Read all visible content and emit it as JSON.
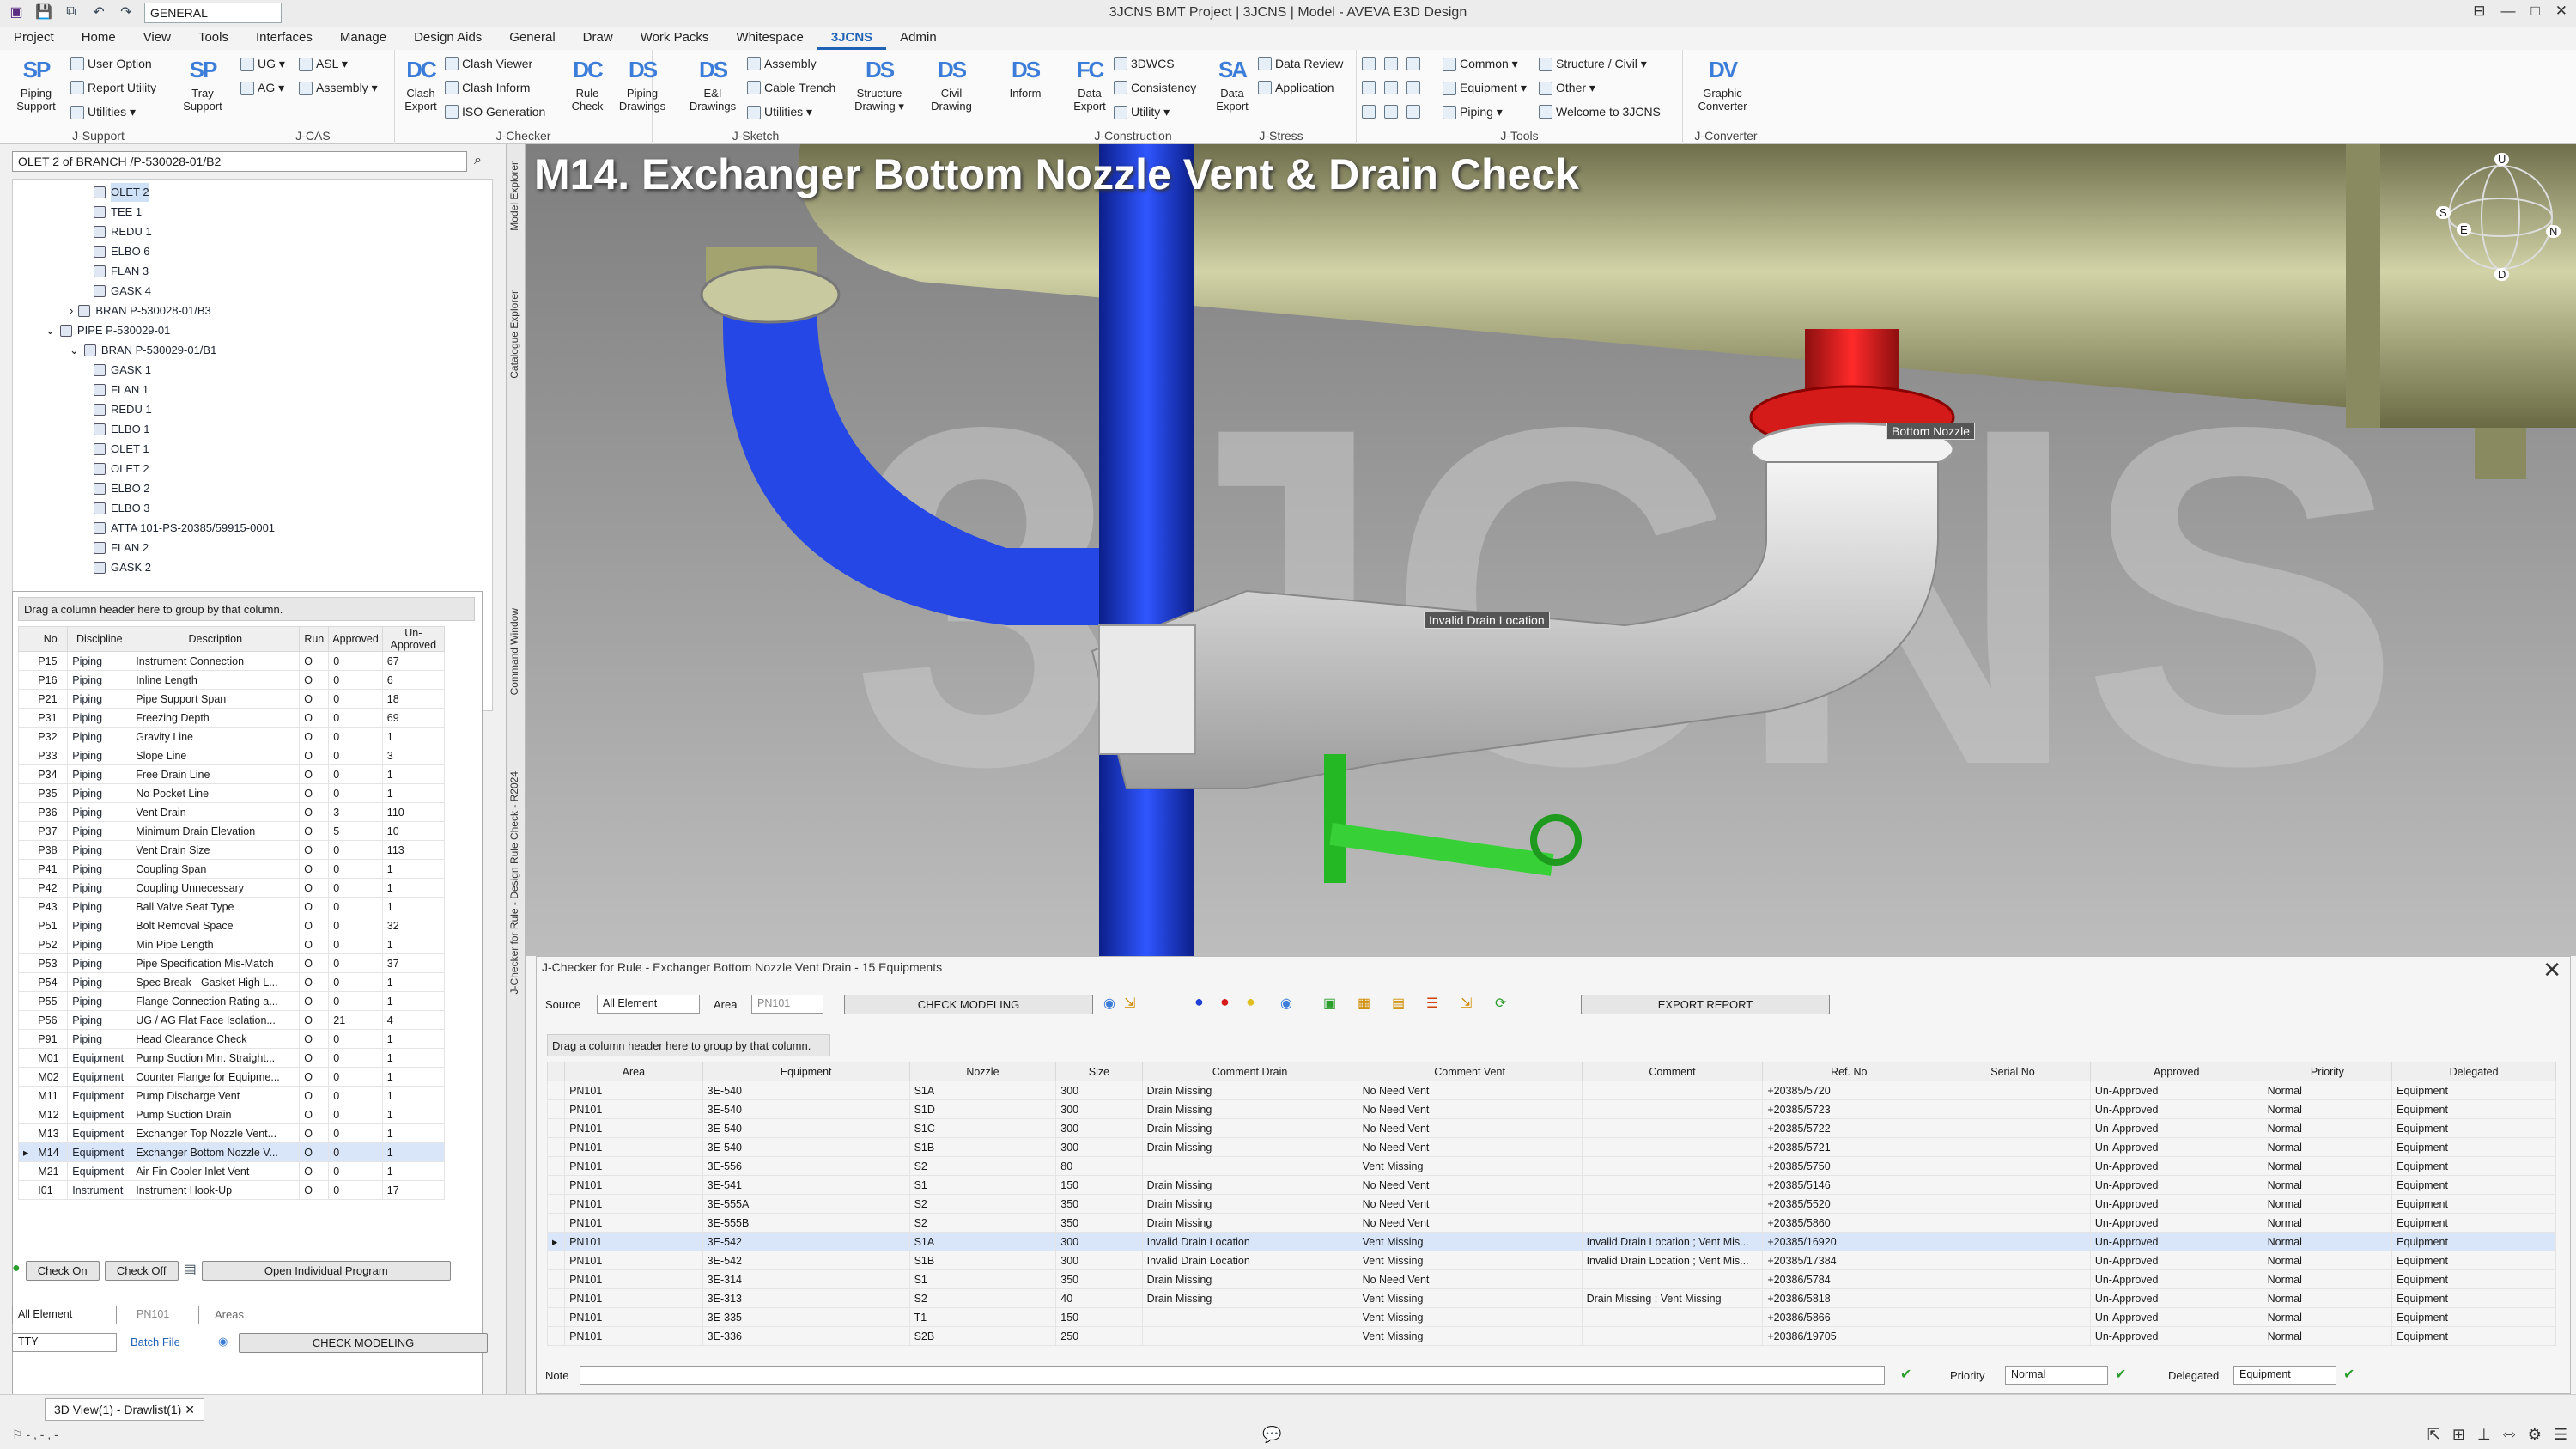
{
  "window": {
    "title": "3JCNS BMT Project | 3JCNS | Model - AVEVA E3D Design",
    "workspace": "GENERAL"
  },
  "menu": [
    "Project",
    "Home",
    "View",
    "Tools",
    "Interfaces",
    "Manage",
    "Design Aids",
    "General",
    "Draw",
    "Work Packs",
    "Whitespace",
    "3JCNS",
    "Admin"
  ],
  "ribbon": {
    "groups": [
      {
        "label": "J-Support",
        "big": [
          {
            "icon": "SP",
            "label": "Piping Support"
          }
        ],
        "small": [
          "User Option",
          "Report Utility",
          "Utilities ▾"
        ],
        "big2": [
          {
            "icon": "SP",
            "label": "Tray Support"
          }
        ]
      },
      {
        "label": "J-CAS",
        "small": [
          "UG ▾",
          "AG ▾",
          "ASL ▾",
          "Assembly ▾"
        ]
      },
      {
        "label": "J-Checker",
        "big": [
          {
            "icon": "DC",
            "label": "Clash Export"
          },
          {
            "icon": "DC",
            "label": "Rule Check"
          }
        ],
        "small": [
          "Clash Viewer",
          "Clash Inform",
          "ISO Generation"
        ]
      },
      {
        "label": "J-Sketch",
        "big": [
          {
            "icon": "DS",
            "label": "Piping Drawings"
          },
          {
            "icon": "DS",
            "label": "E&I Drawings"
          },
          {
            "icon": "DS",
            "label": "Structure Drawing ▾"
          },
          {
            "icon": "DS",
            "label": "Civil Drawing"
          },
          {
            "icon": "DS",
            "label": "Inform"
          }
        ],
        "small": [
          "Assembly",
          "Cable Trench",
          "Utilities ▾"
        ]
      },
      {
        "label": "J-Construction",
        "big": [
          {
            "icon": "FC",
            "label": "Data Export"
          }
        ],
        "small": [
          "3DWCS",
          "Consistency",
          "Utility ▾"
        ]
      },
      {
        "label": "J-Stress",
        "big": [
          {
            "icon": "SA",
            "label": "Data Export"
          }
        ],
        "small": [
          "Data Review",
          "Application"
        ]
      },
      {
        "label": "J-Tools",
        "small": [
          "Common ▾",
          "Equipment ▾",
          "Piping ▾",
          "Structure / Civil ▾",
          "Other ▾",
          "Welcome to 3JCNS"
        ]
      },
      {
        "label": "J-Converter",
        "big": [
          {
            "icon": "DV",
            "label": "Graphic Converter"
          }
        ]
      }
    ]
  },
  "explorer": {
    "address": "OLET 2 of BRANCH /P-530028-01/B2",
    "tabs": [
      "Model Explorer",
      "Catalogue Explorer",
      "Command Window",
      "J-Checker for Rule - Design Rule Check - R2024"
    ],
    "nodes": [
      {
        "label": "OLET 2",
        "indent": 3,
        "selected": true
      },
      {
        "label": "TEE 1",
        "indent": 3
      },
      {
        "label": "REDU 1",
        "indent": 3
      },
      {
        "label": "ELBO 6",
        "indent": 3
      },
      {
        "label": "FLAN 3",
        "indent": 3
      },
      {
        "label": "GASK 4",
        "indent": 3
      },
      {
        "label": "BRAN P-530028-01/B3",
        "indent": 2,
        "expander": "›"
      },
      {
        "label": "PIPE P-530029-01",
        "indent": 1,
        "expander": "⌄"
      },
      {
        "label": "BRAN P-530029-01/B1",
        "indent": 2,
        "expander": "⌄"
      },
      {
        "label": "GASK 1",
        "indent": 3
      },
      {
        "label": "FLAN 1",
        "indent": 3
      },
      {
        "label": "REDU 1",
        "indent": 3
      },
      {
        "label": "ELBO 1",
        "indent": 3
      },
      {
        "label": "OLET 1",
        "indent": 3
      },
      {
        "label": "OLET 2",
        "indent": 3
      },
      {
        "label": "ELBO 2",
        "indent": 3
      },
      {
        "label": "ELBO 3",
        "indent": 3
      },
      {
        "label": "ATTA 101-PS-20385/59915-0001",
        "indent": 3
      },
      {
        "label": "FLAN 2",
        "indent": 3
      },
      {
        "label": "GASK 2",
        "indent": 3
      }
    ]
  },
  "rules": {
    "hint": "Drag a column header here to group by that column.",
    "columns": [
      "No",
      "Discipline",
      "Description",
      "Run",
      "Approved",
      "Un-Approved"
    ],
    "rows": [
      [
        "P15",
        "Piping",
        "Instrument Connection",
        "O",
        "0",
        "67"
      ],
      [
        "P16",
        "Piping",
        "Inline Length",
        "O",
        "0",
        "6"
      ],
      [
        "P21",
        "Piping",
        "Pipe Support Span",
        "O",
        "0",
        "18"
      ],
      [
        "P31",
        "Piping",
        "Freezing Depth",
        "O",
        "0",
        "69"
      ],
      [
        "P32",
        "Piping",
        "Gravity Line",
        "O",
        "0",
        "1"
      ],
      [
        "P33",
        "Piping",
        "Slope Line",
        "O",
        "0",
        "3"
      ],
      [
        "P34",
        "Piping",
        "Free Drain Line",
        "O",
        "0",
        "1"
      ],
      [
        "P35",
        "Piping",
        "No Pocket Line",
        "O",
        "0",
        "1"
      ],
      [
        "P36",
        "Piping",
        "Vent Drain",
        "O",
        "3",
        "110"
      ],
      [
        "P37",
        "Piping",
        "Minimum Drain Elevation",
        "O",
        "5",
        "10"
      ],
      [
        "P38",
        "Piping",
        "Vent Drain Size",
        "O",
        "0",
        "113"
      ],
      [
        "P41",
        "Piping",
        "Coupling Span",
        "O",
        "0",
        "1"
      ],
      [
        "P42",
        "Piping",
        "Coupling Unnecessary",
        "O",
        "0",
        "1"
      ],
      [
        "P43",
        "Piping",
        "Ball Valve Seat Type",
        "O",
        "0",
        "1"
      ],
      [
        "P51",
        "Piping",
        "Bolt Removal Space",
        "O",
        "0",
        "32"
      ],
      [
        "P52",
        "Piping",
        "Min Pipe Length",
        "O",
        "0",
        "1"
      ],
      [
        "P53",
        "Piping",
        "Pipe Specification Mis-Match",
        "O",
        "0",
        "37"
      ],
      [
        "P54",
        "Piping",
        "Spec Break - Gasket High L...",
        "O",
        "0",
        "1"
      ],
      [
        "P55",
        "Piping",
        "Flange Connection Rating a...",
        "O",
        "0",
        "1"
      ],
      [
        "P56",
        "Piping",
        "UG / AG Flat Face Isolation...",
        "O",
        "21",
        "4"
      ],
      [
        "P91",
        "Piping",
        "Head Clearance Check",
        "O",
        "0",
        "1"
      ],
      [
        "M01",
        "Equipment",
        "Pump Suction Min. Straight...",
        "O",
        "0",
        "1"
      ],
      [
        "M02",
        "Equipment",
        "Counter Flange for Equipme...",
        "O",
        "0",
        "1"
      ],
      [
        "M11",
        "Equipment",
        "Pump Discharge Vent",
        "O",
        "0",
        "1"
      ],
      [
        "M12",
        "Equipment",
        "Pump Suction Drain",
        "O",
        "0",
        "1"
      ],
      [
        "M13",
        "Equipment",
        "Exchanger Top Nozzle Vent...",
        "O",
        "0",
        "1"
      ],
      [
        "M14",
        "Equipment",
        "Exchanger Bottom Nozzle V...",
        "O",
        "0",
        "1"
      ],
      [
        "M21",
        "Equipment",
        "Air Fin Cooler Inlet Vent",
        "O",
        "0",
        "1"
      ],
      [
        "I01",
        "Instrument",
        "Instrument Hook-Up",
        "O",
        "0",
        "17"
      ]
    ],
    "selected_index": 26,
    "buttons": {
      "check_on": "Check On",
      "check_off": "Check Off",
      "open_program": "Open Individual Program",
      "check_modeling": "CHECK MODELING",
      "batch_file": "Batch File"
    },
    "filters": {
      "scope": "All Element",
      "area": "PN101",
      "areas_label": "Areas",
      "mode": "TTY"
    }
  },
  "viewport": {
    "title": "M14. Exchanger Bottom Nozzle Vent & Drain Check",
    "labels": {
      "bottom_nozzle": "Bottom Nozzle",
      "invalid_drain": "Invalid Drain Location"
    },
    "compass": [
      "U",
      "S",
      "E",
      "N",
      "D"
    ],
    "watermark": "3JCNS™",
    "colors": {
      "blue_pipe": "#1f3fd6",
      "red_nozzle": "#d61a1a",
      "green_valve": "#2ec12e",
      "vessel": "#a9a97a"
    }
  },
  "jchecker": {
    "title": "J-Checker for Rule - Exchanger Bottom Nozzle Vent  Drain - 15 Equipments",
    "source_label": "Source",
    "source_value": "All Element",
    "area_label": "Area",
    "area_value": "PN101",
    "check_button": "CHECK MODELING",
    "export_button": "EXPORT REPORT",
    "hint": "Drag a column header here to group by that column.",
    "columns": [
      "Area",
      "Equipment",
      "Nozzle",
      "Size",
      "Comment Drain",
      "Comment Vent",
      "Comment",
      "Ref. No",
      "Serial No",
      "Approved",
      "Priority",
      "Delegated"
    ],
    "rows": [
      [
        "PN101",
        "3E-540",
        "S1A",
        "300",
        "Drain Missing",
        "No Need Vent",
        "",
        "+20385/5720",
        "",
        "Un-Approved",
        "Normal",
        "Equipment"
      ],
      [
        "PN101",
        "3E-540",
        "S1D",
        "300",
        "Drain Missing",
        "No Need Vent",
        "",
        "+20385/5723",
        "",
        "Un-Approved",
        "Normal",
        "Equipment"
      ],
      [
        "PN101",
        "3E-540",
        "S1C",
        "300",
        "Drain Missing",
        "No Need Vent",
        "",
        "+20385/5722",
        "",
        "Un-Approved",
        "Normal",
        "Equipment"
      ],
      [
        "PN101",
        "3E-540",
        "S1B",
        "300",
        "Drain Missing",
        "No Need Vent",
        "",
        "+20385/5721",
        "",
        "Un-Approved",
        "Normal",
        "Equipment"
      ],
      [
        "PN101",
        "3E-556",
        "S2",
        "80",
        "",
        "Vent Missing",
        "",
        "+20385/5750",
        "",
        "Un-Approved",
        "Normal",
        "Equipment"
      ],
      [
        "PN101",
        "3E-541",
        "S1",
        "150",
        "Drain Missing",
        "No Need Vent",
        "",
        "+20385/5146",
        "",
        "Un-Approved",
        "Normal",
        "Equipment"
      ],
      [
        "PN101",
        "3E-555A",
        "S2",
        "350",
        "Drain Missing",
        "No Need Vent",
        "",
        "+20385/5520",
        "",
        "Un-Approved",
        "Normal",
        "Equipment"
      ],
      [
        "PN101",
        "3E-555B",
        "S2",
        "350",
        "Drain Missing",
        "No Need Vent",
        "",
        "+20385/5860",
        "",
        "Un-Approved",
        "Normal",
        "Equipment"
      ],
      [
        "PN101",
        "3E-542",
        "S1A",
        "300",
        "Invalid Drain Location",
        "Vent Missing",
        "Invalid Drain Location ; Vent Mis...",
        "+20385/16920",
        "",
        "Un-Approved",
        "Normal",
        "Equipment"
      ],
      [
        "PN101",
        "3E-542",
        "S1B",
        "300",
        "Invalid Drain Location",
        "Vent Missing",
        "Invalid Drain Location ; Vent Mis...",
        "+20385/17384",
        "",
        "Un-Approved",
        "Normal",
        "Equipment"
      ],
      [
        "PN101",
        "3E-314",
        "S1",
        "350",
        "Drain Missing",
        "No Need Vent",
        "",
        "+20386/5784",
        "",
        "Un-Approved",
        "Normal",
        "Equipment"
      ],
      [
        "PN101",
        "3E-313",
        "S2",
        "40",
        "Drain Missing",
        "Vent Missing",
        "Drain Missing ; Vent Missing",
        "+20386/5818",
        "",
        "Un-Approved",
        "Normal",
        "Equipment"
      ],
      [
        "PN101",
        "3E-335",
        "T1",
        "150",
        "",
        "Vent Missing",
        "",
        "+20386/5866",
        "",
        "Un-Approved",
        "Normal",
        "Equipment"
      ],
      [
        "PN101",
        "3E-336",
        "S2B",
        "250",
        "",
        "Vent Missing",
        "",
        "+20386/19705",
        "",
        "Un-Approved",
        "Normal",
        "Equipment"
      ]
    ],
    "selected_index": 8,
    "note_label": "Note",
    "priority_label": "Priority",
    "priority_value": "Normal",
    "delegated_label": "Delegated",
    "delegated_value": "Equipment"
  },
  "status": {
    "doc_tab": "3D View(1) - Drawlist(1)",
    "left_text": "⚐ - , - , -"
  }
}
